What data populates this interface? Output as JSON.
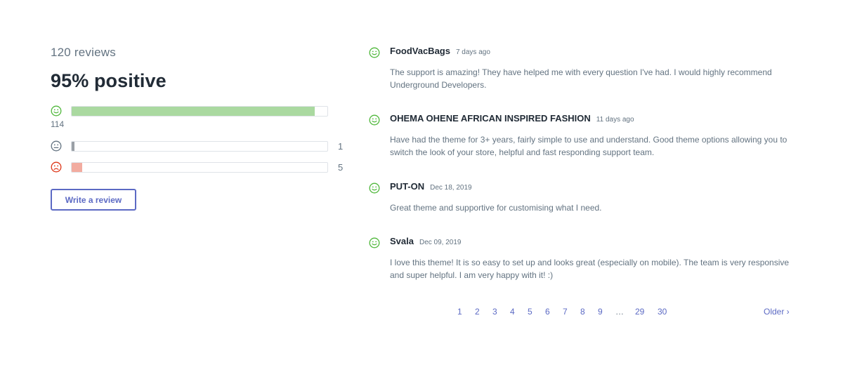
{
  "summary": {
    "review_count": "120 reviews",
    "positive_percent": "95% positive",
    "rows": [
      {
        "sentiment": "positive",
        "icon": "smile-icon",
        "count": "114",
        "fraction": 0.95,
        "color": "#aad9a0"
      },
      {
        "sentiment": "neutral",
        "icon": "neutral-face-icon",
        "count": "1",
        "fraction": 0.01,
        "color": "#9aa0a6"
      },
      {
        "sentiment": "negative",
        "icon": "frown-icon",
        "count": "5",
        "fraction": 0.04,
        "color": "#f2aca0"
      }
    ],
    "write_review_label": "Write a review"
  },
  "reviews": [
    {
      "name": "FoodVacBags",
      "date": "7 days ago",
      "icon": "smile-icon",
      "body": "The support is amazing! They have helped me with every question I've had. I would highly recommend Underground Developers."
    },
    {
      "name": "OHEMA OHENE AFRICAN INSPIRED FASHION",
      "date": "11 days ago",
      "icon": "smile-icon",
      "body": "Have had the theme for 3+ years, fairly simple to use and understand. Good theme options allowing you to switch the look of your store, helpful and fast responding support team."
    },
    {
      "name": "PUT-ON",
      "date": "Dec 18, 2019",
      "icon": "smile-icon",
      "body": "Great theme and supportive for customising what I need."
    },
    {
      "name": "Svala",
      "date": "Dec 09, 2019",
      "icon": "smile-icon",
      "body": "I love this theme! It is so easy to set up and looks great (especially on mobile). The team is very responsive and super helpful. I am very happy with it! :)"
    }
  ],
  "pagination": {
    "pages": [
      "1",
      "2",
      "3",
      "4",
      "5",
      "6",
      "7",
      "8",
      "9"
    ],
    "ellipsis": "…",
    "last_pages": [
      "29",
      "30"
    ],
    "older_label": "Older ›"
  },
  "colors": {
    "accent": "#5c6ac4",
    "positive_icon": "#50b83c",
    "neutral_icon": "#637381",
    "negative_icon": "#de3618"
  }
}
